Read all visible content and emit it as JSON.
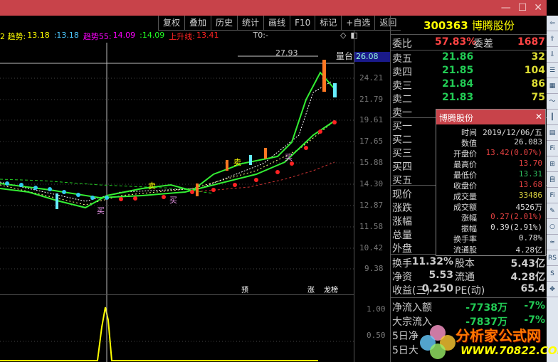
{
  "toolbar": [
    "复权",
    "叠加",
    "历史",
    "统计",
    "画线",
    "F10",
    "标记",
    "+自选",
    "返回"
  ],
  "legend": {
    "l1": "2 趋势:",
    "v1": "13.18",
    "v2": ":13.18",
    "l3": "趋势55:",
    "v3": "14.09",
    "v4": ":14.09",
    "l5": "上升线:",
    "v5": "13.41",
    "t0": "T0:-"
  },
  "chart": {
    "high_label": "27.93",
    "tai_label": "量台",
    "current": "26.08",
    "yticks": [
      "24.21",
      "21.79",
      "19.61",
      "17.65",
      "15.88",
      "14.30",
      "12.87",
      "11.58",
      "10.42",
      "9.38"
    ],
    "signals": {
      "buy": "买",
      "sell": "卖",
      "yu": "预",
      "zhang": "涨",
      "longhu": "龙榜"
    },
    "indicator_ticks": [
      "1.00",
      "0.50"
    ]
  },
  "panel": {
    "code": "300363",
    "name": "博腾股份",
    "weibi_label": "委比",
    "weibi": "57.83%",
    "weicha_label": "委差",
    "weicha": "1687",
    "sell": [
      {
        "l": "卖五",
        "p": "21.86",
        "v": "32"
      },
      {
        "l": "卖四",
        "p": "21.85",
        "v": "104"
      },
      {
        "l": "卖三",
        "p": "21.84",
        "v": "86"
      },
      {
        "l": "卖二",
        "p": "21.83",
        "v": "75"
      },
      {
        "l": "卖一",
        "p": "",
        "v": ""
      }
    ],
    "buy": [
      "买一",
      "买二",
      "买三",
      "买四",
      "买五"
    ],
    "quote": [
      "现价",
      "涨跌",
      "涨幅",
      "总量",
      "外盘"
    ],
    "stats": [
      {
        "a": "换手",
        "av": "11.32%",
        "b": "股本",
        "bv": "5.43亿"
      },
      {
        "a": "净资",
        "av": "5.53",
        "b": "流通",
        "bv": "4.28亿"
      },
      {
        "a": "收益(三)",
        "av": "0.250",
        "b": "PE(动)",
        "bv": "65.4"
      }
    ],
    "flow": [
      {
        "l": "净流入额",
        "v": "-7738万",
        "p": "-7%"
      },
      {
        "l": "大宗流入",
        "v": "-7837万",
        "p": "-7%"
      },
      {
        "l": "5日净",
        "v": "",
        "p": ""
      },
      {
        "l": "5日大",
        "v": "",
        "p": ""
      }
    ]
  },
  "popup": {
    "title": "博腾股份",
    "rows": [
      {
        "k": "时间",
        "v": "2019/12/06/五",
        "c": "#ddd"
      },
      {
        "k": "数值",
        "v": "26.083",
        "c": "#ddd"
      },
      {
        "k": "开盘价",
        "v": "13.42(0.07%)",
        "c": "#e04040"
      },
      {
        "k": "最高价",
        "v": "13.70",
        "c": "#e04040"
      },
      {
        "k": "最低价",
        "v": "13.31",
        "c": "#30c060"
      },
      {
        "k": "收盘价",
        "v": "13.68",
        "c": "#e04040"
      },
      {
        "k": "成交量",
        "v": "33486",
        "c": "#d8d040"
      },
      {
        "k": "成交额",
        "v": "4526万",
        "c": "#ddd"
      },
      {
        "k": "涨幅",
        "v": "0.27(2.01%)",
        "c": "#e04040"
      },
      {
        "k": "振幅",
        "v": "0.39(2.91%)",
        "c": "#ddd"
      },
      {
        "k": "换手率",
        "v": "0.78%",
        "c": "#ddd"
      },
      {
        "k": "流通股",
        "v": "4.28亿",
        "c": "#ddd"
      }
    ]
  },
  "watermark": {
    "title": "分析家公式网",
    "url": "WWW.70822.COM"
  }
}
